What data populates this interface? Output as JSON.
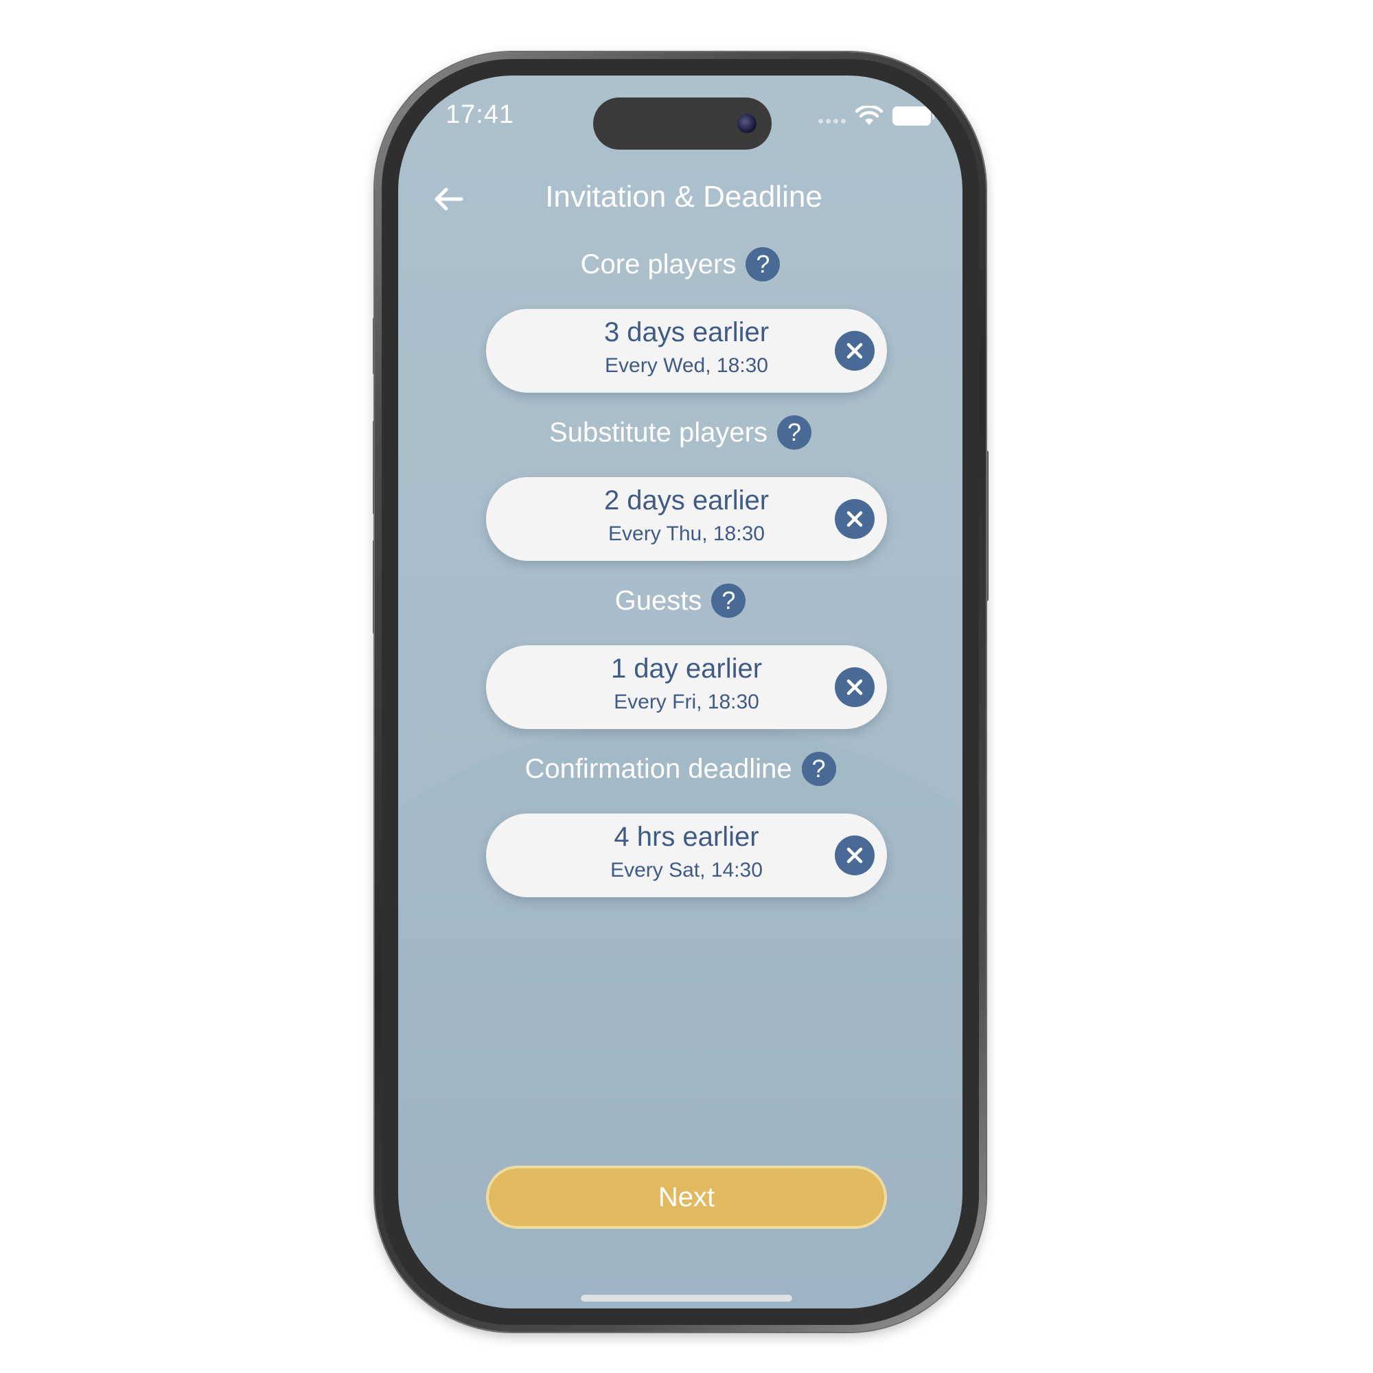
{
  "status_bar": {
    "time": "17:41"
  },
  "header": {
    "title": "Invitation & Deadline",
    "back_icon": "arrow-left-icon"
  },
  "sections": [
    {
      "label": "Core players",
      "help": "?",
      "value": "3 days earlier",
      "schedule": "Every Wed, 18:30"
    },
    {
      "label": "Substitute players",
      "help": "?",
      "value": "2 days earlier",
      "schedule": "Every Thu, 18:30"
    },
    {
      "label": "Guests",
      "help": "?",
      "value": "1 day earlier",
      "schedule": "Every Fri, 18:30"
    },
    {
      "label": "Confirmation deadline",
      "help": "?",
      "value": "4 hrs earlier",
      "schedule": "Every Sat, 14:30"
    }
  ],
  "footer": {
    "next_label": "Next"
  },
  "colors": {
    "background": "#adc0cc",
    "accent_blue": "#4a6a96",
    "text_blue": "#3e5a85",
    "pill_bg": "#f4f4f4",
    "next_button": "#e1b95f"
  }
}
